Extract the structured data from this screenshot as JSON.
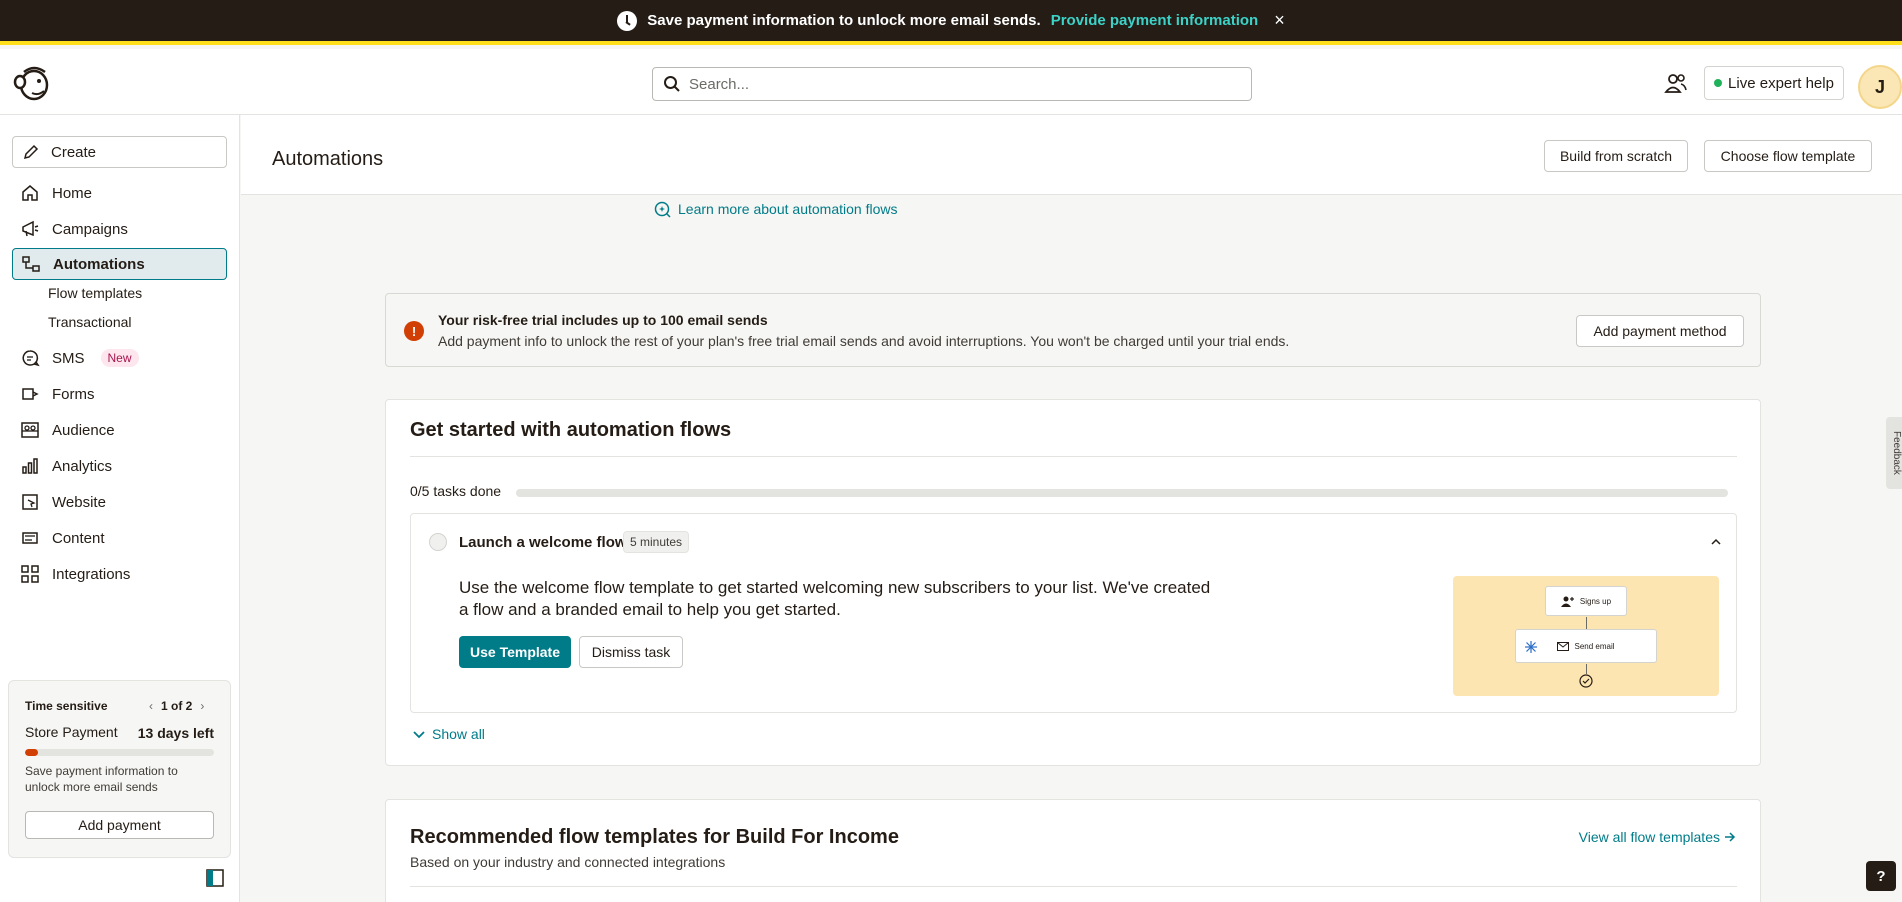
{
  "banner": {
    "message": "Save payment information to unlock more email sends.",
    "link": "Provide payment information",
    "close": "×"
  },
  "header": {
    "search_placeholder": "Search...",
    "expert_help": "Live expert help",
    "avatar_initial": "J"
  },
  "sidebar": {
    "create": "Create",
    "items": [
      {
        "label": "Home",
        "icon": "home-icon"
      },
      {
        "label": "Campaigns",
        "icon": "megaphone-icon"
      },
      {
        "label": "Automations",
        "icon": "automations-icon"
      },
      {
        "label": "SMS",
        "icon": "sms-icon"
      },
      {
        "label": "Forms",
        "icon": "forms-icon"
      },
      {
        "label": "Audience",
        "icon": "audience-icon"
      },
      {
        "label": "Analytics",
        "icon": "analytics-icon"
      },
      {
        "label": "Website",
        "icon": "website-icon"
      },
      {
        "label": "Content",
        "icon": "content-icon"
      },
      {
        "label": "Integrations",
        "icon": "integrations-icon"
      }
    ],
    "sub_items": [
      "Flow templates",
      "Transactional"
    ],
    "sms_badge": "New",
    "time_sensitive": {
      "heading": "Time sensitive",
      "pager": "1 of 2",
      "title": "Store Payment",
      "days_left": "13 days left",
      "progress": 0.07,
      "description": "Save payment information to unlock more email sends",
      "button": "Add payment"
    }
  },
  "page": {
    "title": "Automations",
    "build_from_scratch": "Build from scratch",
    "choose_flow_template": "Choose flow template",
    "learn_more": "Learn more about automation flows"
  },
  "alert": {
    "title": "Your risk-free trial includes up to 100 email sends",
    "body": "Add payment info to unlock the rest of your plan's free trial email sends and avoid interruptions. You won't be charged until your trial ends.",
    "button": "Add payment method"
  },
  "get_started": {
    "title": "Get started with automation flows",
    "progress_label": "0/5 tasks done",
    "progress": 0,
    "task": {
      "name": "Launch a welcome flow",
      "duration": "5 minutes",
      "description": "Use the welcome flow template to get started welcoming new subscribers to your list. We've created a flow and a branded email to help you get started.",
      "primary_button": "Use Template",
      "dismiss_button": "Dismiss task",
      "illustration": {
        "step1": "Signs up",
        "step2": "Send email"
      }
    },
    "show_all": "Show all"
  },
  "recommended": {
    "title": "Recommended flow templates for Build For Income",
    "subtitle": "Based on your industry and connected integrations",
    "view_all": "View all flow templates"
  },
  "feedback": "Feedback",
  "help": "?",
  "colors": {
    "brand_teal": "#007c89",
    "banner_bg": "#241c15",
    "banner_accent": "#ffe01b",
    "link_bright": "#3cd2c8",
    "warning": "#d13f04"
  }
}
